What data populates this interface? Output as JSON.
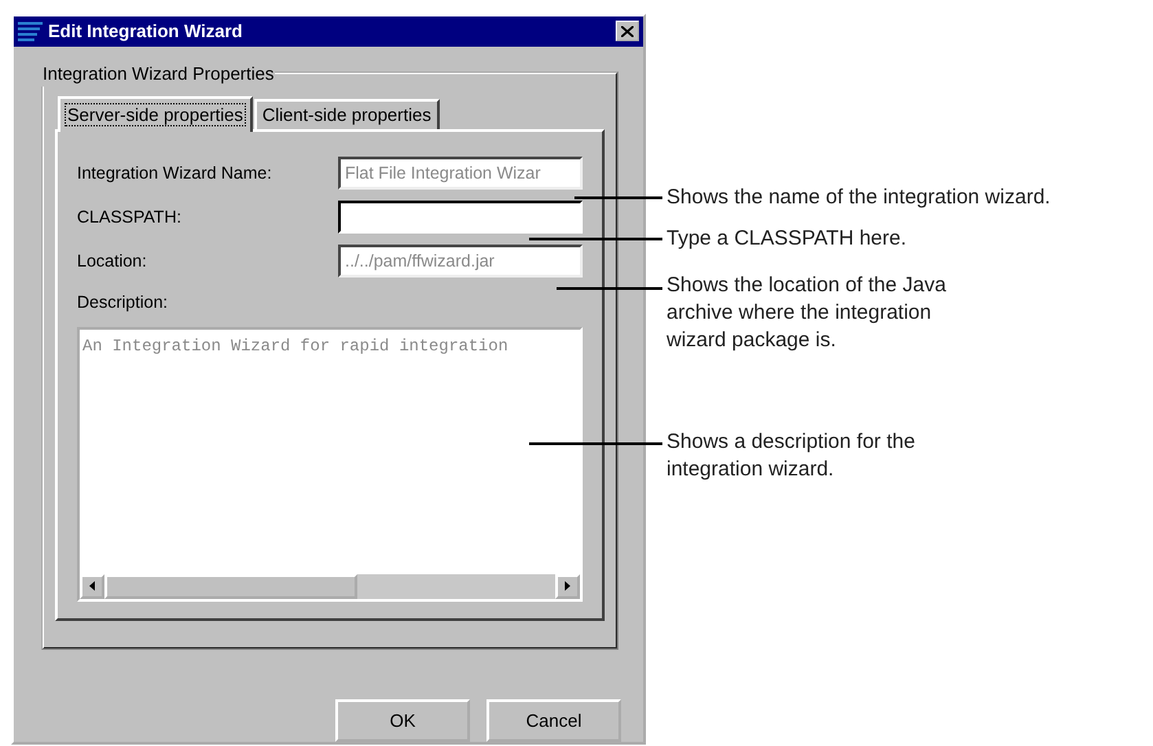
{
  "window": {
    "title": "Edit Integration Wizard"
  },
  "group_title": "Integration Wizard Properties",
  "tabs": [
    {
      "label": "Server-side properties",
      "selected": true
    },
    {
      "label": "Client-side properties",
      "selected": false
    }
  ],
  "fields": [
    {
      "label": "Integration Wizard Name:",
      "value": "Flat File Integration Wizar",
      "disabled": true
    },
    {
      "label": "CLASSPATH:",
      "disabled": false
    },
    {
      "label": "Location:",
      "value": "../../pam/ffwizard.jar",
      "disabled": true
    }
  ],
  "description": {
    "label": "Description:",
    "value": "An Integration Wizard for rapid integration",
    "disabled": true
  },
  "buttons": [
    "OK",
    "Cancel"
  ],
  "callouts": [
    {
      "text": "Shows the name of the integration wizard."
    },
    {
      "text": "Type a CLASSPATH here."
    },
    {
      "text": "Shows the location of the Java archive where the integration wizard package is."
    },
    {
      "text": "Shows a description for the integration wizard."
    }
  ]
}
